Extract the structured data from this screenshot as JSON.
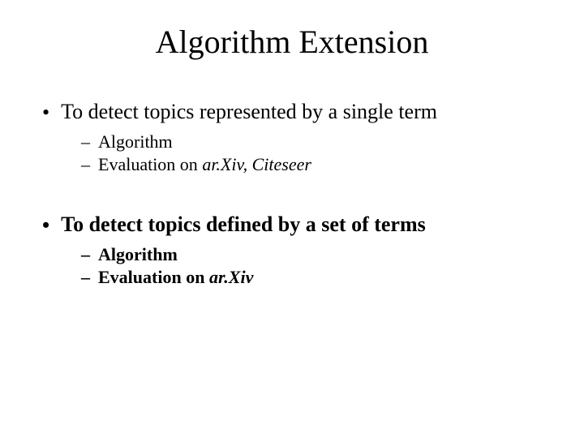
{
  "title": "Algorithm Extension",
  "section1": {
    "heading": "To detect topics represented by a single term",
    "sub1_prefix": "Algorithm",
    "sub2_prefix": "Evaluation on ",
    "sub2_italic": "ar.Xiv, Citeseer"
  },
  "section2": {
    "heading": "To detect topics defined by a set of terms",
    "sub1_prefix": "Algorithm",
    "sub2_prefix": "Evaluation on ",
    "sub2_italic": "ar.Xiv"
  }
}
